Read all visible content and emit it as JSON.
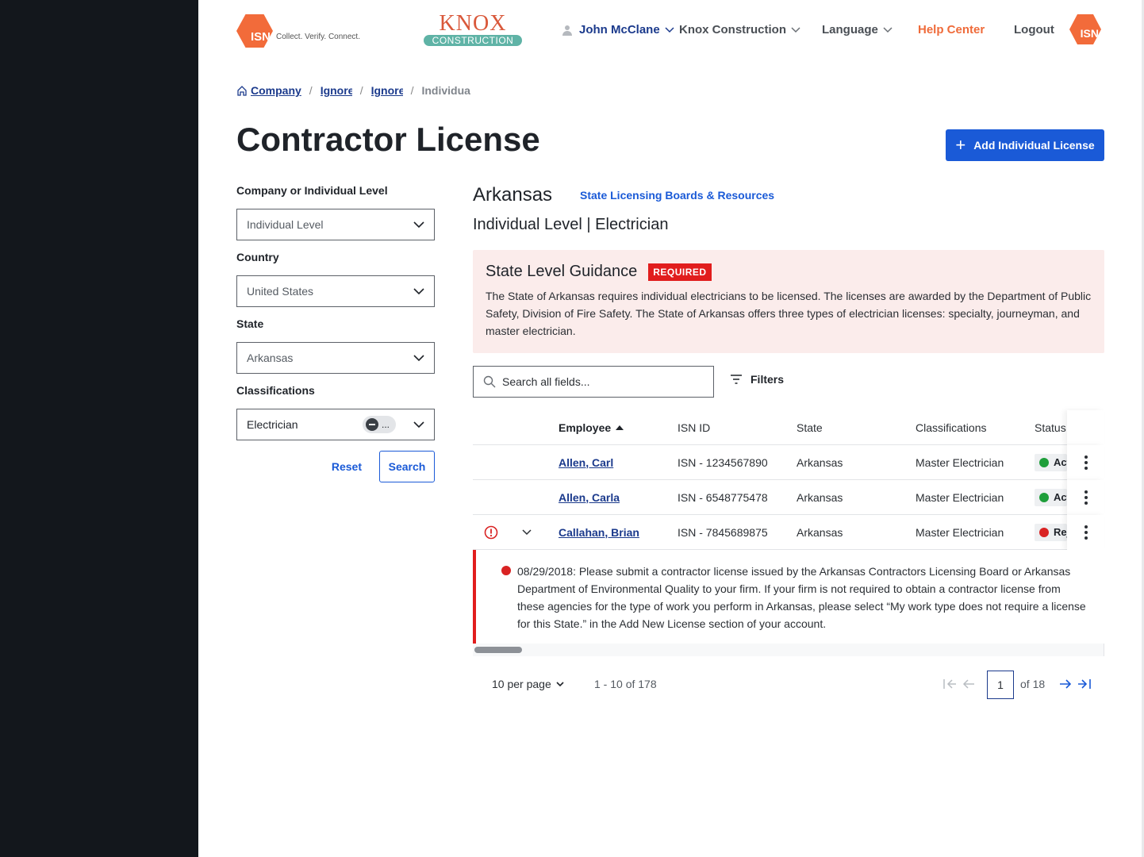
{
  "header": {
    "isn_logo_text": "ISN",
    "isn_tagline": "Collect. Verify. Connect.",
    "knox_name": "KNOX",
    "knox_sub": "CONSTRUCTION",
    "user_name": "John McClane",
    "company": "Knox Construction",
    "language": "Language",
    "help": "Help Center",
    "logout": "Logout",
    "isn_right_text": "ISN"
  },
  "breadcrumb": {
    "items": [
      "Company",
      "Ignore",
      "Ignore",
      "Individual"
    ]
  },
  "page": {
    "title": "Contractor License",
    "add_button": "Add Individual License"
  },
  "filters_panel": {
    "level_label": "Company or Individual Level",
    "level_value": "Individual Level",
    "country_label": "Country",
    "country_value": "United States",
    "state_label": "State",
    "state_value": "Arkansas",
    "class_label": "Classifications",
    "class_value": "Electrician",
    "class_chip_more": "...",
    "reset": "Reset",
    "search": "Search"
  },
  "content": {
    "state_name": "Arkansas",
    "state_link": "State Licensing Boards & Resources",
    "subtitle": "Individual Level | Electrician",
    "guidance_title": "State Level Guidance",
    "guidance_badge": "REQUIRED",
    "guidance_text": "The State of Arkansas requires individual electricians to be licensed. The licenses are awarded by the Department of Public Safety, Division of Fire Safety. The State of Arkansas offers three types of electrician licenses: specialty, journeyman, and master electrician.",
    "search_placeholder": "Search all fields...",
    "filters_label": "Filters"
  },
  "table": {
    "columns": [
      "Employee",
      "ISN ID",
      "State",
      "Classifications",
      "Status"
    ],
    "rows": [
      {
        "employee": "Allen, Carl",
        "isn_id": "ISN - 1234567890",
        "state": "Arkansas",
        "classification": "Master Electrician",
        "status": "Active",
        "status_color": "#1e9e3a"
      },
      {
        "employee": "Allen, Carla",
        "isn_id": "ISN - 6548775478",
        "state": "Arkansas",
        "classification": "Master Electrician",
        "status": "Active",
        "status_color": "#1e9e3a"
      },
      {
        "employee": "Callahan, Brian",
        "isn_id": "ISN - 7845689875",
        "state": "Arkansas",
        "classification": "Master Electrician",
        "status": "Rejected",
        "status_color": "#d92323"
      }
    ],
    "expanded_message": "08/29/2018: Please submit a contractor license issued by the Arkansas Contractors Licensing Board or Arkansas Department of Environmental Quality to your firm. If your firm is not required to obtain a contractor license from these agencies for the type of work you perform in Arkansas, please select “My work type does not require a license for this State.” in the Add New License section of your account."
  },
  "pagination": {
    "per_page": "10 per page",
    "range": "1 - 10 of 178",
    "current_page": "1",
    "of_pages": "of 18"
  },
  "colors": {
    "primary": "#1a5ad7",
    "link": "#1b3a8c",
    "brand_orange": "#f26b3a",
    "required_red": "#e11d1d",
    "guidance_bg": "#fbeceb"
  }
}
